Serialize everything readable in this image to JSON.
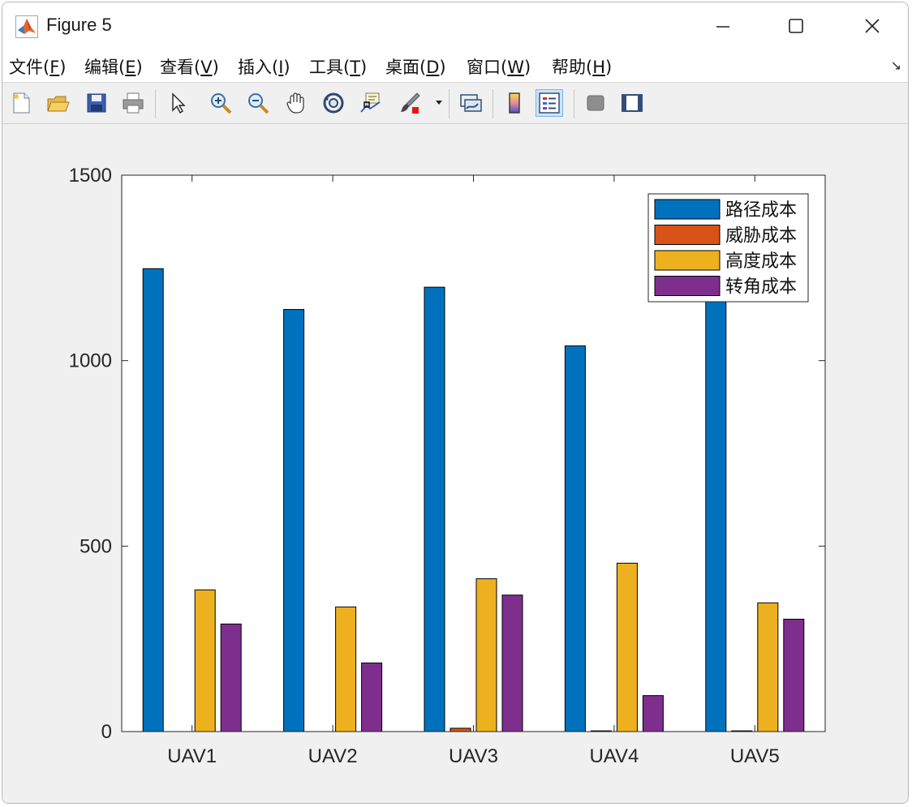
{
  "window": {
    "title": "Figure 5",
    "controls": {
      "minimize": "—",
      "maximize": "☐",
      "close": "✕"
    }
  },
  "menu": [
    {
      "label": "文件(",
      "key": "F",
      "end": ")"
    },
    {
      "label": "编辑(",
      "key": "E",
      "end": ")"
    },
    {
      "label": "查看(",
      "key": "V",
      "end": ")"
    },
    {
      "label": "插入(",
      "key": "I",
      "end": ")"
    },
    {
      "label": "工具(",
      "key": "T",
      "end": ")"
    },
    {
      "label": "桌面(",
      "key": "D",
      "end": ")"
    },
    {
      "label": "窗口(",
      "key": "W",
      "end": ")"
    },
    {
      "label": "帮助(",
      "key": "H",
      "end": ")"
    }
  ],
  "toolbar_icons": [
    "new-figure-icon",
    "open-file-icon",
    "save-icon",
    "print-icon",
    "pointer-icon",
    "zoom-in-icon",
    "zoom-out-icon",
    "pan-icon",
    "rotate-3d-icon",
    "data-cursor-icon",
    "brush-icon",
    "link-plot-icon",
    "colorbar-icon",
    "legend-icon",
    "hide-plot-tools-icon",
    "show-plot-tools-icon"
  ],
  "colors": {
    "path": "#0072BD",
    "threat": "#D95319",
    "height": "#EDB120",
    "turn": "#7E2F8E"
  },
  "chart_data": {
    "type": "bar",
    "categories": [
      "UAV1",
      "UAV2",
      "UAV3",
      "UAV4",
      "UAV5"
    ],
    "series": [
      {
        "name": "路径成本",
        "values": [
          1248,
          1138,
          1198,
          1040,
          1200
        ],
        "color": "#0072BD"
      },
      {
        "name": "威胁成本",
        "values": [
          0,
          0,
          9,
          2,
          2
        ],
        "color": "#D95319"
      },
      {
        "name": "高度成本",
        "values": [
          382,
          336,
          412,
          454,
          347
        ],
        "color": "#EDB120"
      },
      {
        "name": "转角成本",
        "values": [
          290,
          185,
          368,
          97,
          303
        ],
        "color": "#7E2F8E"
      }
    ],
    "ylim": [
      0,
      1500
    ],
    "yticks": [
      0,
      500,
      1000,
      1500
    ],
    "legend_position": "top-right",
    "grid": false
  }
}
